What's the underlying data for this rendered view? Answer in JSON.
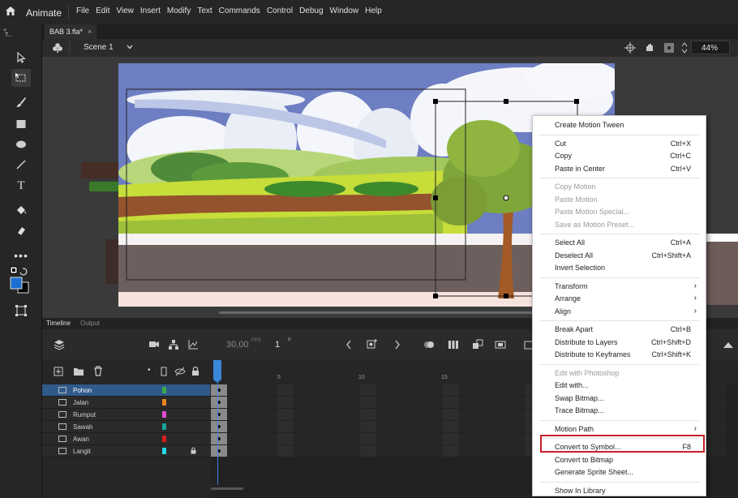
{
  "menubar": {
    "app_name": "Animate",
    "menus": [
      "File",
      "Edit",
      "View",
      "Insert",
      "Modify",
      "Text",
      "Commands",
      "Control",
      "Debug",
      "Window",
      "Help"
    ]
  },
  "toolbar_header": {
    "label": "T..."
  },
  "document": {
    "tab_title": "BAB 3.fla*",
    "tab_close": "×",
    "scene": "Scene 1",
    "zoom": "44%"
  },
  "timeline": {
    "tabs": [
      "Timeline",
      "Output"
    ],
    "fps": "30,00",
    "fps_unit": "FPS",
    "current_frame": "1",
    "frame_markers": [
      "5",
      "10",
      "15"
    ],
    "layers": [
      {
        "name": "Pohon",
        "color": "#3aa84a",
        "active": true,
        "locked": false
      },
      {
        "name": "Jalan",
        "color": "#e7841e",
        "active": false,
        "locked": false
      },
      {
        "name": "Rumput",
        "color": "#e34cd2",
        "active": false,
        "locked": false
      },
      {
        "name": "Sawah",
        "color": "#19a29a",
        "active": false,
        "locked": false
      },
      {
        "name": "Awan",
        "color": "#d91c1c",
        "active": false,
        "locked": false
      },
      {
        "name": "Langit",
        "color": "#26d8e6",
        "active": false,
        "locked": true
      }
    ]
  },
  "context_menu": {
    "items": [
      {
        "label": "Create Motion Tween",
        "shortcut": "",
        "disabled": false
      },
      {
        "label": "Cut",
        "shortcut": "Ctrl+X",
        "disabled": false
      },
      {
        "label": "Copy",
        "shortcut": "Ctrl+C",
        "disabled": false
      },
      {
        "label": "Paste in Center",
        "shortcut": "Ctrl+V",
        "disabled": false
      },
      {
        "label": "Copy Motion",
        "shortcut": "",
        "disabled": true
      },
      {
        "label": "Paste Motion",
        "shortcut": "",
        "disabled": true
      },
      {
        "label": "Paste Motion Special...",
        "shortcut": "",
        "disabled": true
      },
      {
        "label": "Save as Motion Preset...",
        "shortcut": "",
        "disabled": true
      },
      {
        "label": "Select All",
        "shortcut": "Ctrl+A",
        "disabled": false
      },
      {
        "label": "Deselect All",
        "shortcut": "Ctrl+Shift+A",
        "disabled": false
      },
      {
        "label": "Invert Selection",
        "shortcut": "",
        "disabled": false
      },
      {
        "label": "Transform",
        "shortcut": "",
        "disabled": false,
        "submenu": true
      },
      {
        "label": "Arrange",
        "shortcut": "",
        "disabled": false,
        "submenu": true
      },
      {
        "label": "Align",
        "shortcut": "",
        "disabled": false,
        "submenu": true
      },
      {
        "label": "Break Apart",
        "shortcut": "Ctrl+B",
        "disabled": false
      },
      {
        "label": "Distribute to Layers",
        "shortcut": "Ctrl+Shift+D",
        "disabled": false
      },
      {
        "label": "Distribute to Keyframes",
        "shortcut": "Ctrl+Shift+K",
        "disabled": false
      },
      {
        "label": "Edit with Photoshop",
        "shortcut": "",
        "disabled": true
      },
      {
        "label": "Edit with...",
        "shortcut": "",
        "disabled": false
      },
      {
        "label": "Swap Bitmap...",
        "shortcut": "",
        "disabled": false
      },
      {
        "label": "Trace Bitmap...",
        "shortcut": "",
        "disabled": false
      },
      {
        "label": "Motion Path",
        "shortcut": "",
        "disabled": false,
        "submenu": true
      },
      {
        "label": "Convert to Symbol...",
        "shortcut": "F8",
        "disabled": false,
        "highlighted": true
      },
      {
        "label": "Convert to Bitmap",
        "shortcut": "",
        "disabled": false
      },
      {
        "label": "Generate Sprite Sheet...",
        "shortcut": "",
        "disabled": false
      },
      {
        "label": "Show In Library",
        "shortcut": "",
        "disabled": false
      }
    ],
    "submenu_arrow": "›",
    "highlight_color": "#c8202a"
  }
}
